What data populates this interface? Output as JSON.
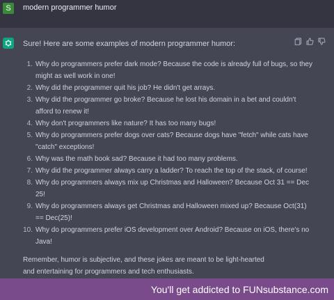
{
  "user": {
    "avatar_letter": "S",
    "message": "modern programmer humor"
  },
  "assistant": {
    "intro": "Sure! Here are some examples of modern programmer humor:",
    "jokes": [
      {
        "num": "1.",
        "text": "Why do programmers prefer dark mode? Because the code is already full of bugs, so they might as well work in one!"
      },
      {
        "num": "2.",
        "text": "Why did the programmer quit his job? He didn't get arrays."
      },
      {
        "num": "3.",
        "text": "Why did the programmer go broke? Because he lost his domain in a bet and couldn't afford to renew it!"
      },
      {
        "num": "4.",
        "text": "Why don't programmers like nature? It has too many bugs!"
      },
      {
        "num": "5.",
        "text": "Why do programmers prefer dogs over cats? Because dogs have \"fetch\" while cats have \"catch\" exceptions!"
      },
      {
        "num": "6.",
        "text": "Why was the math book sad? Because it had too many problems."
      },
      {
        "num": "7.",
        "text": "Why did the programmer always carry a ladder? To reach the top of the stack, of course!"
      },
      {
        "num": "8.",
        "text": "Why do programmers always mix up Christmas and Halloween? Because Oct 31 == Dec 25!"
      },
      {
        "num": "9.",
        "text": "Why do programmers always get Christmas and Halloween mixed up? Because Oct(31) == Dec(25)!"
      },
      {
        "num": "10.",
        "text": "Why do programmers prefer iOS development over Android? Because on iOS, there's no Java!"
      }
    ],
    "outro": "Remember, humor is subjective, and these jokes are meant to be light-hearted and entertaining for programmers and tech enthusiasts.",
    "actions": [
      "copy-icon",
      "thumbs-up-icon",
      "thumbs-down-icon"
    ]
  },
  "watermark": {
    "text": "You'll get addicted to FUNsubstance.com"
  },
  "colors": {
    "bg_user": "#343541",
    "bg_assistant": "#444654",
    "accent": "#10a37f",
    "watermark_bg": "#7a4b8a"
  }
}
